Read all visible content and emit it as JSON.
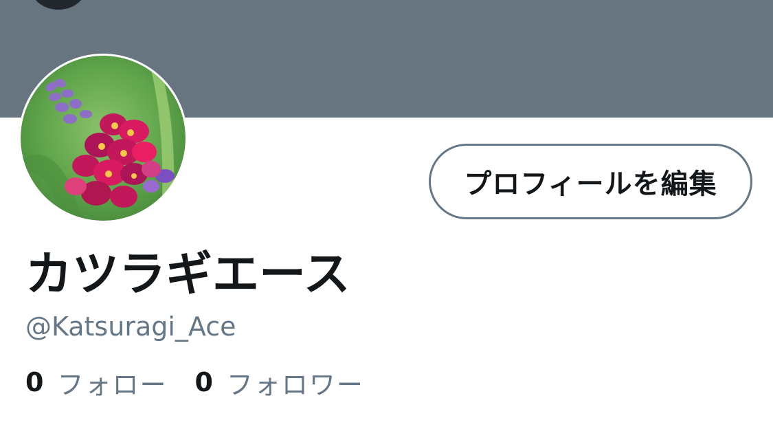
{
  "profile": {
    "display_name": "カツラギエース",
    "username": "@Katsuragi_Ace",
    "edit_button_label": "プロフィールを編集",
    "avatar_alt": "flower-avatar"
  },
  "stats": {
    "following_count": "0",
    "following_label": "フォロー",
    "followers_count": "0",
    "followers_label": "フォロワー"
  },
  "colors": {
    "banner": "#66757f",
    "text_primary": "#14171a",
    "text_secondary": "#657786",
    "button_border": "#657786"
  }
}
